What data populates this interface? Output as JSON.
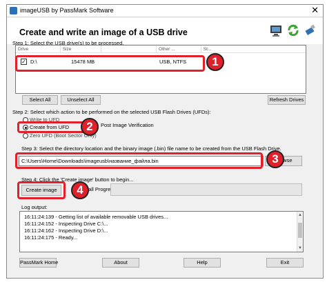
{
  "window": {
    "title": "imageUSB by PassMark Software",
    "close_glyph": "✕"
  },
  "header": {
    "title": "Create and write an image of a USB drive",
    "icons": [
      "computer-icon",
      "refresh-arrows-icon",
      "usb-drive-icon"
    ]
  },
  "step1": {
    "label": "Step 1: Select the USB drive(s) to be processed.",
    "columns": [
      "Drive",
      "Size",
      "",
      "Other ...",
      "St..."
    ],
    "drives": [
      {
        "checked": true,
        "drive": "D:\\",
        "size": "15478 MB",
        "type": "USB, NTFS"
      }
    ],
    "select_all": "Select All",
    "unselect_all": "Unselect All",
    "refresh": "Refresh Drives"
  },
  "step2": {
    "label": "Step 2: Select which action to be performed on the selected USB Flash Drives (UFDs):",
    "options": [
      "Write to UFD",
      "Create from UFD",
      "Zero UFD (Boot Sector Only)"
    ],
    "selected": "Create from UFD",
    "post_verify": "Post Image Verification"
  },
  "step3": {
    "label": "Step 3: Select the directory location and the binary image (.bin) file name to be created from the USB Flash Drive.",
    "path": "C:\\Users\\Home\\Downloads\\imageusb\\название_файла.bin",
    "browse": "Browse"
  },
  "step4": {
    "label": "Step 4: Click the 'Create image' button to begin...",
    "create_button": "Create image",
    "progress_label": "Overall Progress"
  },
  "log": {
    "label": "Log output:",
    "lines": [
      "16:11:24:139 - Getting list of available removable USB drives...",
      "16:11:24:152 - Inspecting Drive C:\\...",
      "16:11:24:162 - Inspecting Drive D:\\...",
      "16:11:24:175 - Ready..."
    ]
  },
  "footer": {
    "passmark_home": "PassMark Home",
    "about": "About",
    "help": "Help",
    "exit": "Exit"
  },
  "annotations": {
    "badges": [
      "1",
      "2",
      "3",
      "4"
    ],
    "color": "#e0202a"
  }
}
